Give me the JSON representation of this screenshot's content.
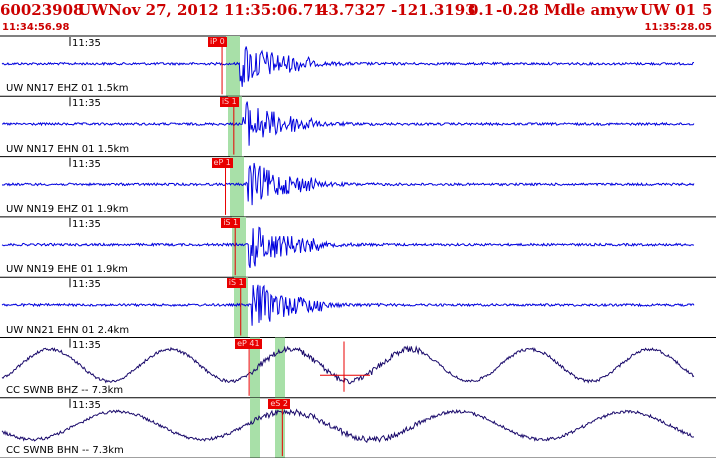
{
  "header": {
    "event_id": "60023908",
    "network": "UW",
    "origin_time": "Nov 27, 2012 11:35:06.71",
    "lat_lon": "43.7327 -121.3193",
    "depth": "0.1",
    "magnitude": "-0.28 Md",
    "author": "le amyw",
    "network_version": "UW 01",
    "trailing": "5",
    "start_time": "11:34:56.98",
    "end_time": "11:35:28.05"
  },
  "colors": {
    "title": "#cc0000",
    "trace_high": "#0000dd",
    "trace_low": "#1a0a6b",
    "pick_window": "#a8e0a8",
    "pick_marker": "#e80000",
    "divider": "#000000"
  },
  "traces": [
    {
      "label": "UW NN17 EHZ 01 1.5km",
      "time_tick": "11:35",
      "pick": "iP 0",
      "kind": "high",
      "pick_t": 0.318
    },
    {
      "label": "UW NN17 EHN 01 1.5km",
      "time_tick": "11:35",
      "pick": "iS 1",
      "kind": "high",
      "pick_t": 0.335
    },
    {
      "label": "UW NN19 EHZ 01 1.9km",
      "time_tick": "11:35",
      "pick": "eP 1",
      "kind": "high",
      "pick_t": 0.323
    },
    {
      "label": "UW NN19 EHE 01 1.9km",
      "time_tick": "11:35",
      "pick": "iS 1",
      "kind": "high",
      "pick_t": 0.337
    },
    {
      "label": "UW NN21 EHN 01 2.4km",
      "time_tick": "11:35",
      "pick": "iS 1",
      "kind": "high",
      "pick_t": 0.345
    },
    {
      "label": "CC SWNB BHZ -- 7.3km",
      "time_tick": "11:35",
      "pick": "eP 41",
      "kind": "low",
      "pick_t": 0.386
    },
    {
      "label": "CC SWNB BHN -- 7.3km",
      "time_tick": "11:35",
      "pick": "eS 2",
      "kind": "low",
      "pick_t": 0.434
    }
  ]
}
